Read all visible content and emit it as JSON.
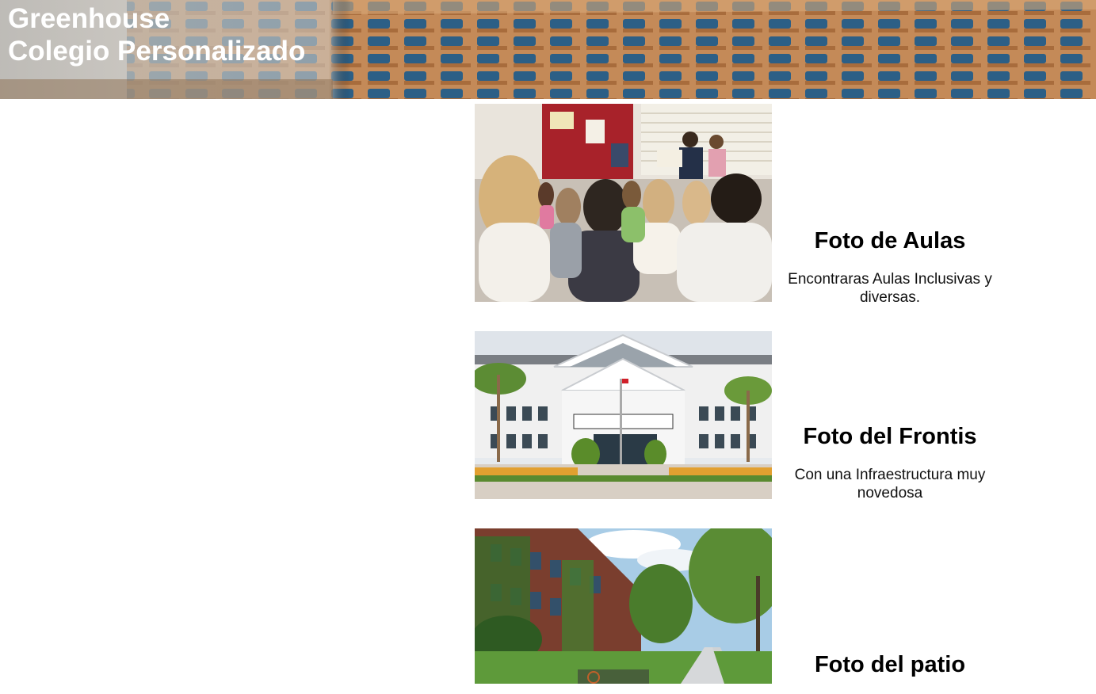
{
  "header": {
    "title_line1": "Greenhouse",
    "title_line2": "Colegio Personalizado"
  },
  "sections": [
    {
      "title": "Foto de Aulas",
      "description": "Encontraras Aulas Inclusivas y diversas."
    },
    {
      "title": "Foto del Frontis",
      "description": "Con una Infraestructura muy novedosa"
    },
    {
      "title": "Foto del patio",
      "description": ""
    }
  ]
}
